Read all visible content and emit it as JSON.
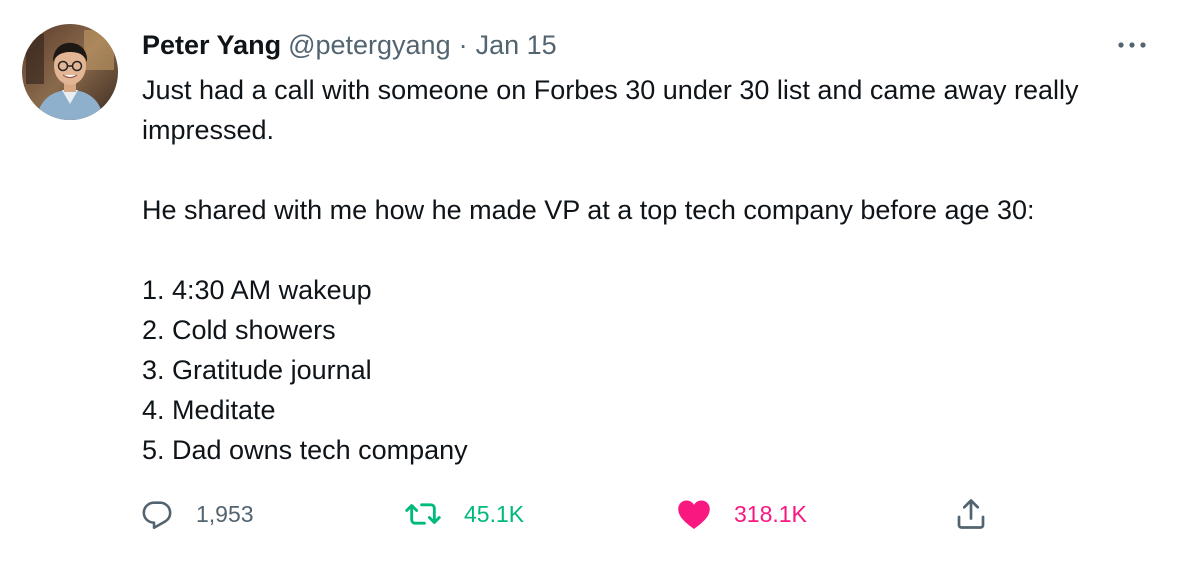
{
  "tweet": {
    "author": {
      "name": "Peter Yang",
      "handle": "@petergyang",
      "separator": "·",
      "date": "Jan 15",
      "avatar_icon": "profile-photo"
    },
    "more_icon": "more-horizontal-icon",
    "paragraphs": [
      "Just had a call with someone on Forbes 30 under 30 list and came away really impressed.",
      "He shared with me how he made VP at a top tech company before age 30:"
    ],
    "list": [
      "1. 4:30 AM wakeup",
      "2. Cold showers",
      "3. Gratitude journal",
      "4. Meditate",
      "5. Dad owns tech company"
    ],
    "actions": {
      "reply": {
        "icon": "reply-icon",
        "count": "1,953",
        "color": "#536471"
      },
      "retweet": {
        "icon": "retweet-icon",
        "count": "45.1K",
        "color": "#00ba7c"
      },
      "like": {
        "icon": "heart-icon",
        "count": "318.1K",
        "color": "#f91880"
      },
      "share": {
        "icon": "share-icon",
        "color": "#536471"
      }
    }
  }
}
